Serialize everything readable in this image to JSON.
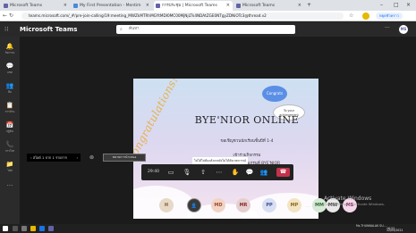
{
  "browser": {
    "tabs": [
      {
        "title": "Microsoft Teams",
        "color": "#6264a7"
      },
      {
        "title": "My First Presentation - Mentim",
        "color": "#4a89dc"
      },
      {
        "title": "การประชุม | Microsoft Teams",
        "color": "#6264a7"
      },
      {
        "title": "Microsoft Teams",
        "color": "#6264a7"
      }
    ],
    "url": "teams.microsoft.com/_#/pre-join-calling/19:meeting_MWZkMTRhMGYtMDI0MC00MjNjLTk4NDAtZGE0NTgyZDNiOTc3@thread.v2",
    "paused_label": "หยุดชั่วคราว"
  },
  "teams": {
    "app_name": "Microsoft Teams",
    "search_placeholder": "ค้นหา",
    "avatar_initials": "MS",
    "rail": [
      {
        "icon": "activity-icon",
        "label": "กิจกรรม"
      },
      {
        "icon": "chat-icon",
        "label": "แชท"
      },
      {
        "icon": "teams-icon",
        "label": "ทีม"
      },
      {
        "icon": "assignments-icon",
        "label": "การบ้าน"
      },
      {
        "icon": "calendar-icon",
        "label": "ปฏิทิน"
      },
      {
        "icon": "calls-icon",
        "label": "การโทร"
      },
      {
        "icon": "files-icon",
        "label": "ไฟล์"
      },
      {
        "icon": "more-icon",
        "label": "..."
      }
    ]
  },
  "slide": {
    "side_text": "Congratulations!",
    "bubble_congrats": "Congrats",
    "bubble_achievement": "To your achievement",
    "title": "BYE'NIOR ONLINE",
    "line1": "ขอเชิญชวนนักเรียนชั้นปีที่ 1-4",
    "line2": "เข้าร่วมกิจกรรม",
    "line3": "ร้องแสดงความยินดีแก่รุ่นพี่ BYE'NIOR",
    "date_line": "ในวันที่ 12 พฤษภาคม 2564 เวลา 19.00 - 20.00 น."
  },
  "meeting": {
    "caption": "ไม่ได้ไปต้องสังเกตยังไม่ได้สังเกตการณ์",
    "pager_text": "สไลด์ 1 จาก 1 รายการ",
    "widen_label": "ขยายการนำเสนอ",
    "elapsed": "29:40",
    "controls": [
      "camera-icon",
      "mic-icon",
      "share-icon",
      "more-options-icon",
      "raise-hand-icon",
      "chat-icon",
      "participants-icon"
    ],
    "leave_icon": "phone-hangup-icon"
  },
  "participants": [
    {
      "initials": "H",
      "bg": "#e6d9c8",
      "fg": "#8a5a2b"
    },
    {
      "initials": "",
      "bg": "#3a3a3a",
      "fg": "#fff"
    },
    {
      "initials": "MD",
      "bg": "#f1d4c6",
      "fg": "#a24a2a"
    },
    {
      "initials": "MR",
      "bg": "#e5cfcf",
      "fg": "#8a2e2e"
    },
    {
      "initials": "PP",
      "bg": "#d8dff2",
      "fg": "#3a4f9b"
    },
    {
      "initials": "MP",
      "bg": "#f2e4c4",
      "fg": "#8a6a1a"
    },
    {
      "initials": "MM",
      "bg": "#d7e8d7",
      "fg": "#2f6b2f"
    },
    {
      "initials": "MW",
      "bg": "#e8e8e8",
      "fg": "#444"
    },
    {
      "initials": "MS",
      "bg": "#f2d8e8",
      "fg": "#8a2e6b"
    }
  ],
  "participants_more": "...",
  "windows": {
    "activate_title": "Activate Windows",
    "activate_sub": "Go to Settings to activate Windows.",
    "user": "Ms.THUNNALAK SU...",
    "time": "18:53",
    "date": "12/05/2021"
  }
}
